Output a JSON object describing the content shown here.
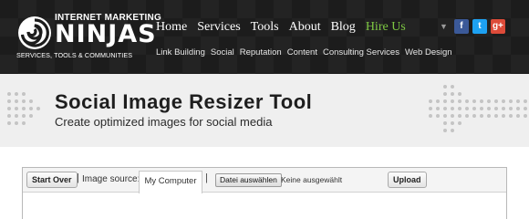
{
  "brand": {
    "top_line": "INTERNET MARKETING",
    "main": "NINJAS",
    "tagline": "SERVICES, TOOLS & COMMUNITIES"
  },
  "main_nav": [
    {
      "label": "Home"
    },
    {
      "label": "Services"
    },
    {
      "label": "Tools"
    },
    {
      "label": "About"
    },
    {
      "label": "Blog"
    },
    {
      "label": "Hire Us"
    }
  ],
  "sub_nav": [
    {
      "label": "Link Building"
    },
    {
      "label": "Social"
    },
    {
      "label": "Reputation"
    },
    {
      "label": "Content"
    },
    {
      "label": "Consulting Services"
    },
    {
      "label": "Web Design"
    }
  ],
  "social": {
    "facebook": "f",
    "twitter": "t",
    "googleplus": "g+"
  },
  "banner": {
    "title": "Social Image Resizer Tool",
    "subtitle": "Create optimized images for social media"
  },
  "tool": {
    "start_over": "Start Over",
    "separator": "|",
    "source_label": "Image source:",
    "source_tab": "My Computer",
    "file_button": "Datei auswählen",
    "file_status": "Keine ausgewählt",
    "upload": "Upload"
  },
  "colors": {
    "header_bg": "#1c1c1c",
    "accent_green": "#7dc742",
    "facebook": "#3b5998",
    "twitter": "#1da1f2",
    "googleplus": "#dd4b39",
    "banner_bg": "#efefef"
  }
}
